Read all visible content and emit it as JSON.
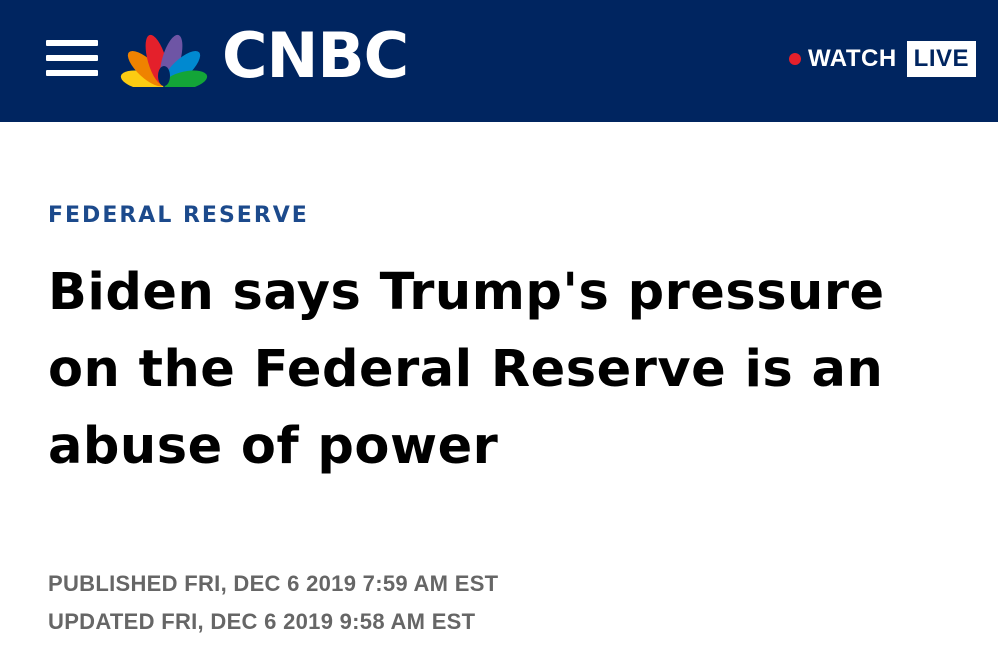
{
  "header": {
    "brand": "CNBC",
    "logo_icon": "nbc-peacock-icon",
    "menu_icon": "hamburger-menu-icon",
    "watch_label": "WATCH",
    "live_label": "LIVE",
    "background_color": "#002560",
    "live_dot_color": "#e4202b"
  },
  "article": {
    "section": "FEDERAL RESERVE",
    "section_color": "#1c4a8c",
    "headline": "Biden says Trump's pressure on the Federal Reserve is an abuse of power",
    "published": "PUBLISHED FRI, DEC 6 2019 7:59 AM EST",
    "updated": "UPDATED FRI, DEC 6 2019 9:58 AM EST"
  }
}
